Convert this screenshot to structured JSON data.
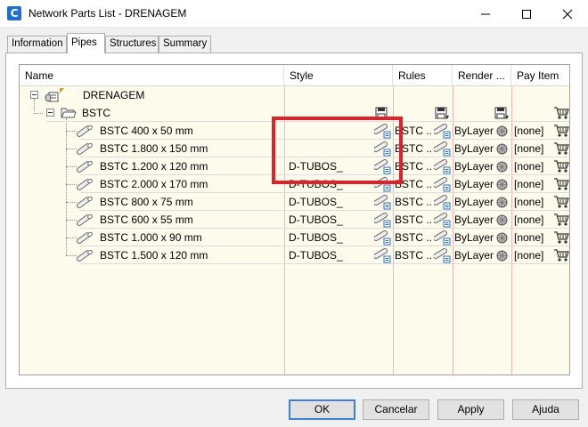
{
  "window": {
    "title": "Network Parts List - DRENAGEM",
    "app_icon_letter": "C"
  },
  "tabs": [
    {
      "label": "Information",
      "active": false
    },
    {
      "label": "Pipes",
      "active": true
    },
    {
      "label": "Structures",
      "active": false
    },
    {
      "label": "Summary",
      "active": false
    }
  ],
  "grid": {
    "columns": [
      "Name",
      "Style",
      "Rules",
      "Render ...",
      "Pay Item"
    ],
    "network_name": "DRENAGEM",
    "family_name": "BSTC",
    "rows": [
      {
        "name": "BSTC 400 x 50 mm",
        "style": "",
        "rules": "BSTC ...",
        "render": "ByLayer",
        "pay_item": "[none]"
      },
      {
        "name": "BSTC 1.800 x 150 mm",
        "style": "",
        "rules": "BSTC ...",
        "render": "ByLayer",
        "pay_item": "[none]"
      },
      {
        "name": "BSTC 1.200 x 120 mm",
        "style": "D-TUBOS_",
        "rules": "BSTC ...",
        "render": "ByLayer",
        "pay_item": "[none]"
      },
      {
        "name": "BSTC 2.000 x 170 mm",
        "style": "D-TUBOS_",
        "rules": "BSTC ...",
        "render": "ByLayer",
        "pay_item": "[none]"
      },
      {
        "name": "BSTC 800 x 75 mm",
        "style": "D-TUBOS_",
        "rules": "BSTC ...",
        "render": "ByLayer",
        "pay_item": "[none]"
      },
      {
        "name": "BSTC 600 x 55 mm",
        "style": "D-TUBOS_",
        "rules": "BSTC ...",
        "render": "ByLayer",
        "pay_item": "[none]"
      },
      {
        "name": "BSTC 1.000 x 90 mm",
        "style": "D-TUBOS_",
        "rules": "BSTC ...",
        "render": "ByLayer",
        "pay_item": "[none]"
      },
      {
        "name": "BSTC 1.500 x 120 mm",
        "style": "D-TUBOS_",
        "rules": "BSTC ...",
        "render": "ByLayer",
        "pay_item": "[none]"
      }
    ]
  },
  "buttons": {
    "ok": "OK",
    "cancel": "Cancelar",
    "apply": "Apply",
    "help": "Ajuda"
  },
  "colors": {
    "highlight": "#e0202a",
    "grid_background": "#fdfbec",
    "column_divider": "#f3b6b6",
    "primary_button_border": "#3c82d6"
  }
}
